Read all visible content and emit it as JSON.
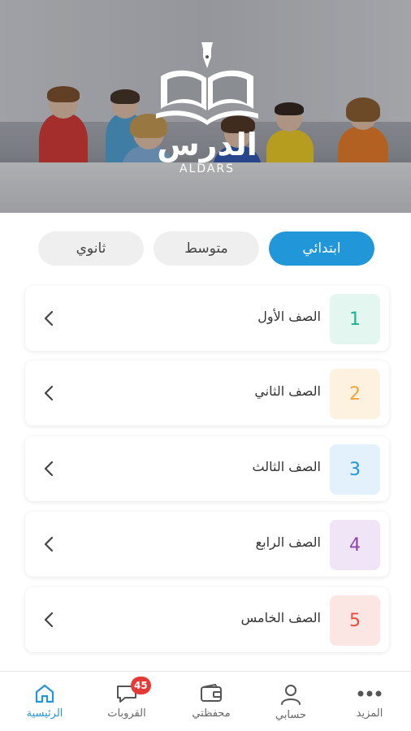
{
  "hero": {
    "logo_arabic": "الدرس",
    "logo_english": "ALDARS"
  },
  "level_tabs": [
    {
      "label": "ابتدائي",
      "active": true
    },
    {
      "label": "متوسط",
      "active": false
    },
    {
      "label": "ثانوي",
      "active": false
    }
  ],
  "grades": [
    {
      "number": "1",
      "label": "الصف الأول",
      "color": "#1ab394",
      "bg": "#e3f6f0"
    },
    {
      "number": "2",
      "label": "الصف الثاني",
      "color": "#f2a23a",
      "bg": "#fdf1e0"
    },
    {
      "number": "3",
      "label": "الصف الثالث",
      "color": "#2196d9",
      "bg": "#e2f1fb"
    },
    {
      "number": "4",
      "label": "الصف الرابع",
      "color": "#8e44ad",
      "bg": "#efe5f6"
    },
    {
      "number": "5",
      "label": "الصف الخامس",
      "color": "#e74c3c",
      "bg": "#fce6e4"
    }
  ],
  "bottom_nav": {
    "home": {
      "label": "الرئيسية",
      "icon": "home-icon"
    },
    "groups": {
      "label": "القروبات",
      "icon": "chat-icon",
      "badge": "45"
    },
    "wallet": {
      "label": "محفظتي",
      "icon": "wallet-icon"
    },
    "account": {
      "label": "حسابي",
      "icon": "user-icon"
    },
    "more": {
      "label": "المزيد",
      "icon": "more-icon"
    }
  },
  "colors": {
    "accent": "#2196d9",
    "badge": "#e53935"
  }
}
